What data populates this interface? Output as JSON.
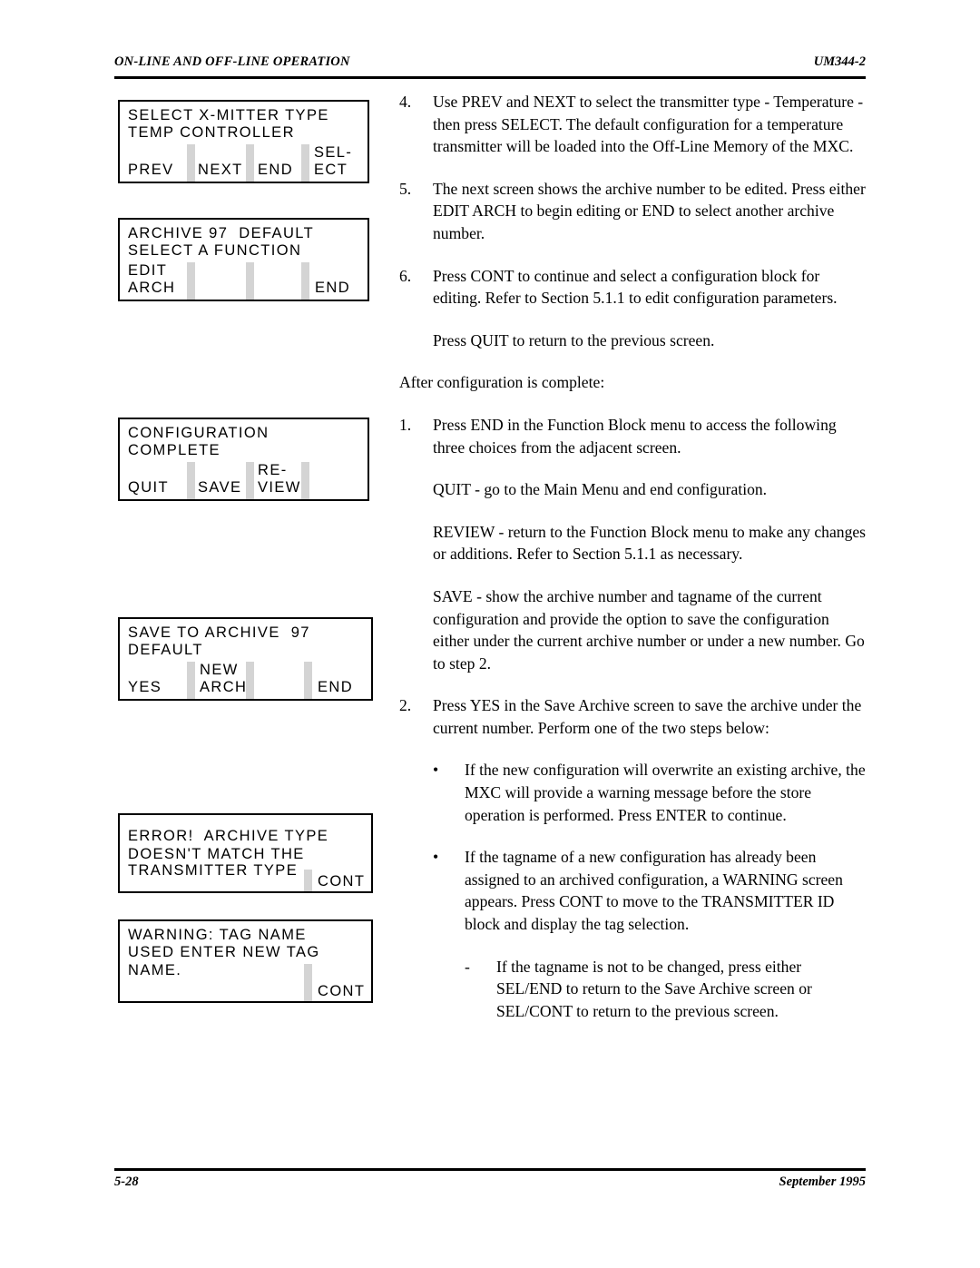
{
  "header": {
    "left_title": "ON-LINE AND OFF-LINE OPERATION",
    "right_title": "UM344-2"
  },
  "footer": {
    "page_number": "5-28",
    "date": "September 1995"
  },
  "colors": {
    "ink": "#000000",
    "separator_gray": "#d4d4d4",
    "paper": "#ffffff"
  },
  "lcd_panels": [
    {
      "id": "select-xmitter-type",
      "lines": [
        "SELECT X-MITTER TYPE",
        "TEMP CONTROLLER"
      ],
      "softkeys": [
        "PREV",
        "NEXT",
        "END",
        "SEL-",
        "ECT"
      ],
      "softkey_labels": {
        "prev": "PREV",
        "next": "NEXT",
        "end": "END",
        "select_top": "SEL-",
        "select_bottom": "ECT"
      }
    },
    {
      "id": "archive-select-function",
      "lines": [
        "ARCHIVE 97  DEFAULT",
        "SELECT A FUNCTION"
      ],
      "softkey_labels": {
        "edit_top": "EDIT",
        "edit_bottom": "ARCH",
        "end": "END"
      }
    },
    {
      "id": "configuration-complete",
      "lines": [
        "CONFIGURATION",
        "COMPLETE"
      ],
      "softkey_labels": {
        "quit": "QUIT",
        "save": "SAVE",
        "review_top": "RE-",
        "review_bottom": "VIEW"
      }
    },
    {
      "id": "save-to-archive",
      "lines": [
        "SAVE TO ARCHIVE  97",
        "DEFAULT"
      ],
      "softkey_labels": {
        "yes": "YES",
        "new_top": "NEW",
        "new_bottom": "ARCH",
        "end": "END"
      }
    },
    {
      "id": "error-archive-type",
      "lines": [
        "ERROR!  ARCHIVE TYPE",
        "DOESN'T MATCH THE",
        "TRANSMITTER TYPE"
      ],
      "softkey_labels": {
        "cont": "CONT"
      }
    },
    {
      "id": "warning-tag-name",
      "lines": [
        "WARNING: TAG NAME",
        "USED ENTER NEW TAG",
        "NAME."
      ],
      "softkey_labels": {
        "cont": "CONT"
      }
    }
  ],
  "body": {
    "step4": {
      "marker": "4.",
      "text": "Use PREV and NEXT to select the transmitter type - Temperature - then press SELECT.  The default configuration for a temperature transmitter will be loaded into the Off-Line Memory of the MXC."
    },
    "step5": {
      "marker": "5.",
      "text": "The next screen shows the archive number to be edited.  Press either EDIT ARCH to begin editing or END to select another archive number."
    },
    "step6": {
      "marker": "6.",
      "text": "Press CONT to continue and select a configuration block for editing.  Refer to Section 5.1.1 to edit configuration parameters."
    },
    "quit_note": "Press QUIT to return to the previous screen.",
    "after_config": "After configuration is complete:",
    "item1": {
      "marker": "1.",
      "text": "Press END in the Function Block menu to access the following three choices from the adjacent screen."
    },
    "quit_choice": "QUIT - go to the Main Menu and end configuration.",
    "review_choice": "REVIEW - return to the Function Block menu to make any changes or additions.  Refer to Section 5.1.1 as necessary.",
    "save_choice": "SAVE - show the archive number and tagname of the current configuration and provide the option to save the configuration either under the current archive number or under a new number.  Go to step 2.",
    "item2": {
      "marker": "2.",
      "text": "Press YES in the Save Archive screen to save the archive under the current number.  Perform one of the two steps below:"
    },
    "bullet1": {
      "marker": "•",
      "text": "If the new configuration will overwrite an existing archive, the MXC will provide a warning message before the store operation is performed.  Press ENTER to continue."
    },
    "bullet2": {
      "marker": "•",
      "text": "If the tagname of a new configuration has already been assigned to an archived configuration, a WARNING screen appears.  Press CONT to move to the TRANSMITTER ID block and display the tag selection."
    },
    "subdash1": {
      "marker": "-",
      "text": "If the tagname is not to be changed, press either SEL/END to return to the Save Archive screen or SEL/CONT to return to the previous screen."
    }
  }
}
